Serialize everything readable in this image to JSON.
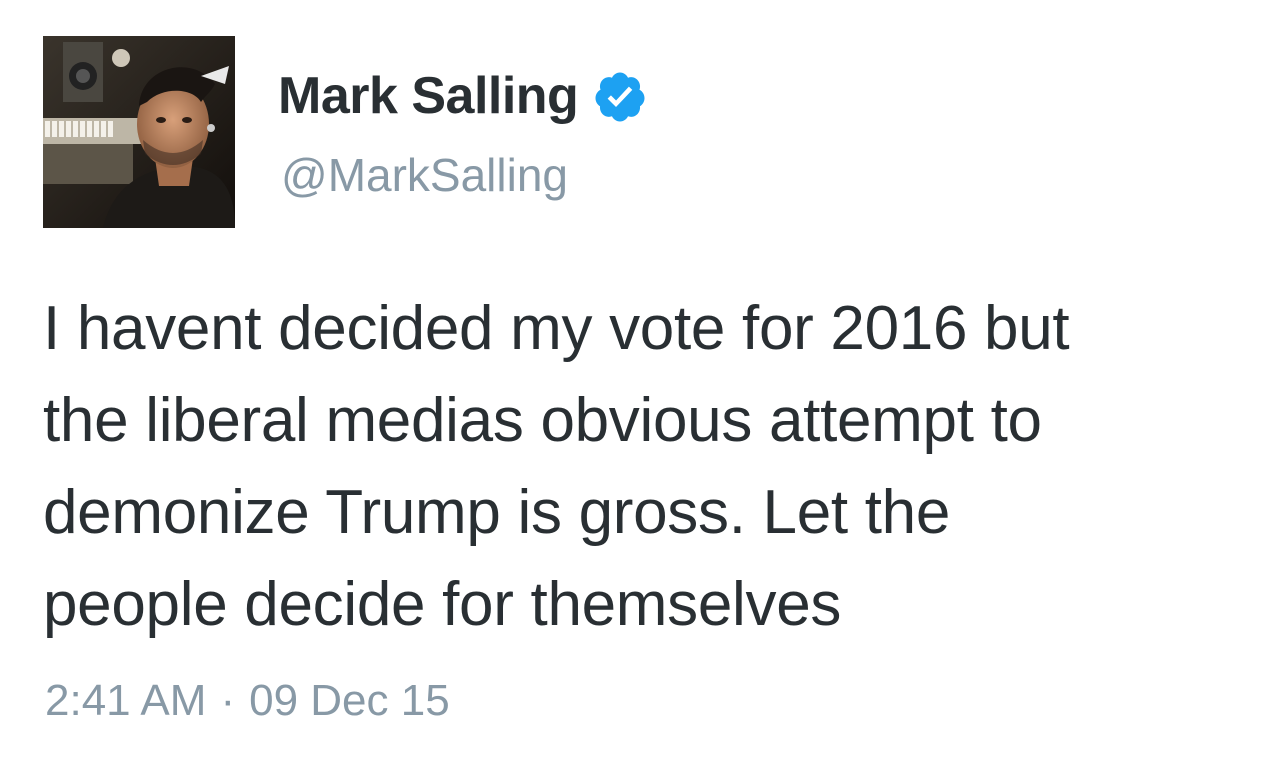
{
  "tweet": {
    "display_name": "Mark Salling",
    "handle": "@MarkSalling",
    "verified_icon": "verified-badge-icon",
    "text_lines": [
      "I havent decided my vote for 2016 but",
      "the liberal medias obvious attempt to",
      "demonize Trump is gross. Let the",
      "people decide for themselves"
    ],
    "time": "2:41 AM",
    "separator": "·",
    "date": "09 Dec 15"
  },
  "colors": {
    "text": "#292f33",
    "secondary": "#8899a6",
    "verified": "#1da1f2",
    "background": "#ffffff"
  }
}
